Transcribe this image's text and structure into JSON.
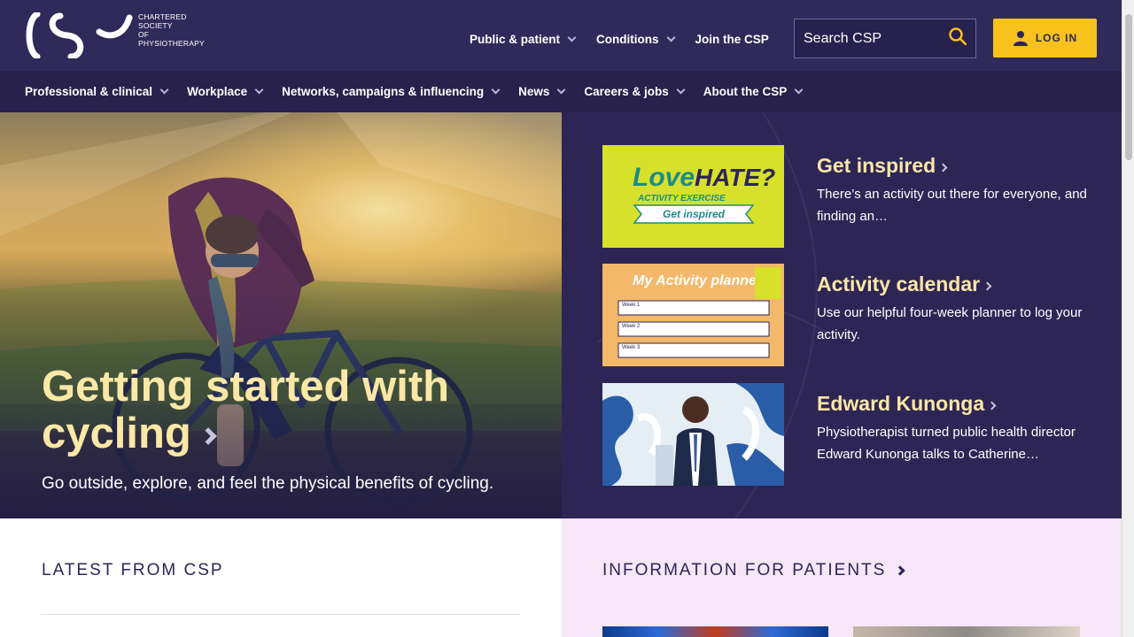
{
  "brand": {
    "logo_lines": [
      "CHARTERED",
      "SOCIETY",
      "OF",
      "PHYSIOTHERAPY"
    ]
  },
  "top_links": [
    {
      "label": "Public & patient",
      "has_dropdown": true
    },
    {
      "label": "Conditions",
      "has_dropdown": true
    },
    {
      "label": "Join the CSP",
      "has_dropdown": false
    }
  ],
  "search": {
    "placeholder": "Search CSP",
    "icon": "search-icon"
  },
  "login": {
    "label": "LOG IN",
    "icon": "user-icon"
  },
  "nav": [
    {
      "label": "Professional & clinical"
    },
    {
      "label": "Workplace"
    },
    {
      "label": "Networks, campaigns & influencing"
    },
    {
      "label": "News"
    },
    {
      "label": "Careers & jobs"
    },
    {
      "label": "About the CSP"
    }
  ],
  "hero": {
    "title": "Getting started with cycling",
    "subtitle": "Go outside, explore, and feel the physical benefits of cycling."
  },
  "cards": [
    {
      "title": "Get inspired",
      "desc": "There’s an activity out there for everyone, and finding an…",
      "thumb_text": [
        "Love",
        "HATE?",
        "ACTIVITY EXERCISE",
        "Get inspired"
      ]
    },
    {
      "title": "Activity calendar",
      "desc": "Use our helpful four-week planner to log your activity.",
      "thumb_text": [
        "My Activity planner",
        "Week 1",
        "Week 2",
        "Week 3"
      ]
    },
    {
      "title": "Edward Kunonga",
      "desc": "Physiotherapist turned public health director Edward Kunonga talks to Catherine…"
    }
  ],
  "sections": {
    "latest": "LATEST FROM CSP",
    "patients": "INFORMATION FOR PATIENTS"
  },
  "colors": {
    "primary": "#2d2655",
    "accent": "#f6c21b",
    "headline": "#fbe7a6",
    "patients_bg": "#f6e6f7"
  }
}
